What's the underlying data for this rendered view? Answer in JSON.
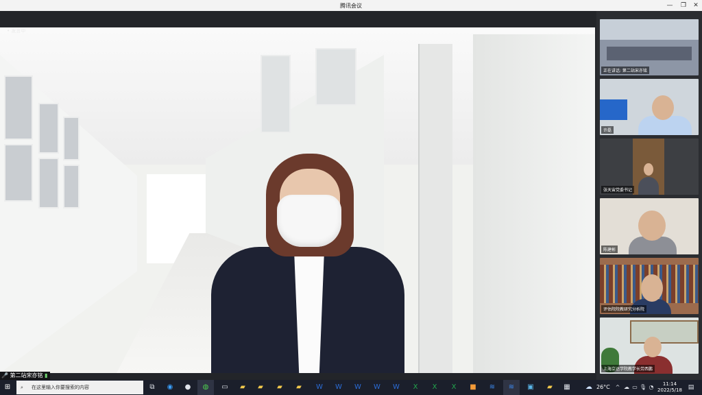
{
  "window": {
    "title": "腾讯会议"
  },
  "main": {
    "top_mic_label": "• 发言中",
    "speaker_name": "第二站宋亦铭",
    "signal_icon": "signal-bars-icon"
  },
  "sidebar": {
    "tiles": [
      {
        "name": "正在讲话: 第二站宋亦铭",
        "bg": "#8d96a6"
      },
      {
        "name": "许磊",
        "bg": "#cfd6dc"
      },
      {
        "name": "张天宙党委书记",
        "bg": "#3d3f43"
      },
      {
        "name": "陈建彬",
        "bg": "#e3ded6"
      },
      {
        "name": "评估院院教研究分析院",
        "bg": "#9c6b4d"
      },
      {
        "name": "上海立达学院教学长劳西鹏",
        "bg": "#dde3e2"
      }
    ]
  },
  "taskbar": {
    "search_placeholder": "在这里输入你要搜索的内容",
    "weather": "26°C",
    "time": "11:14",
    "date": "2022/5/18",
    "colors": {
      "taskbar": "#1b1f2b",
      "accent": "#2d7ff9"
    }
  }
}
